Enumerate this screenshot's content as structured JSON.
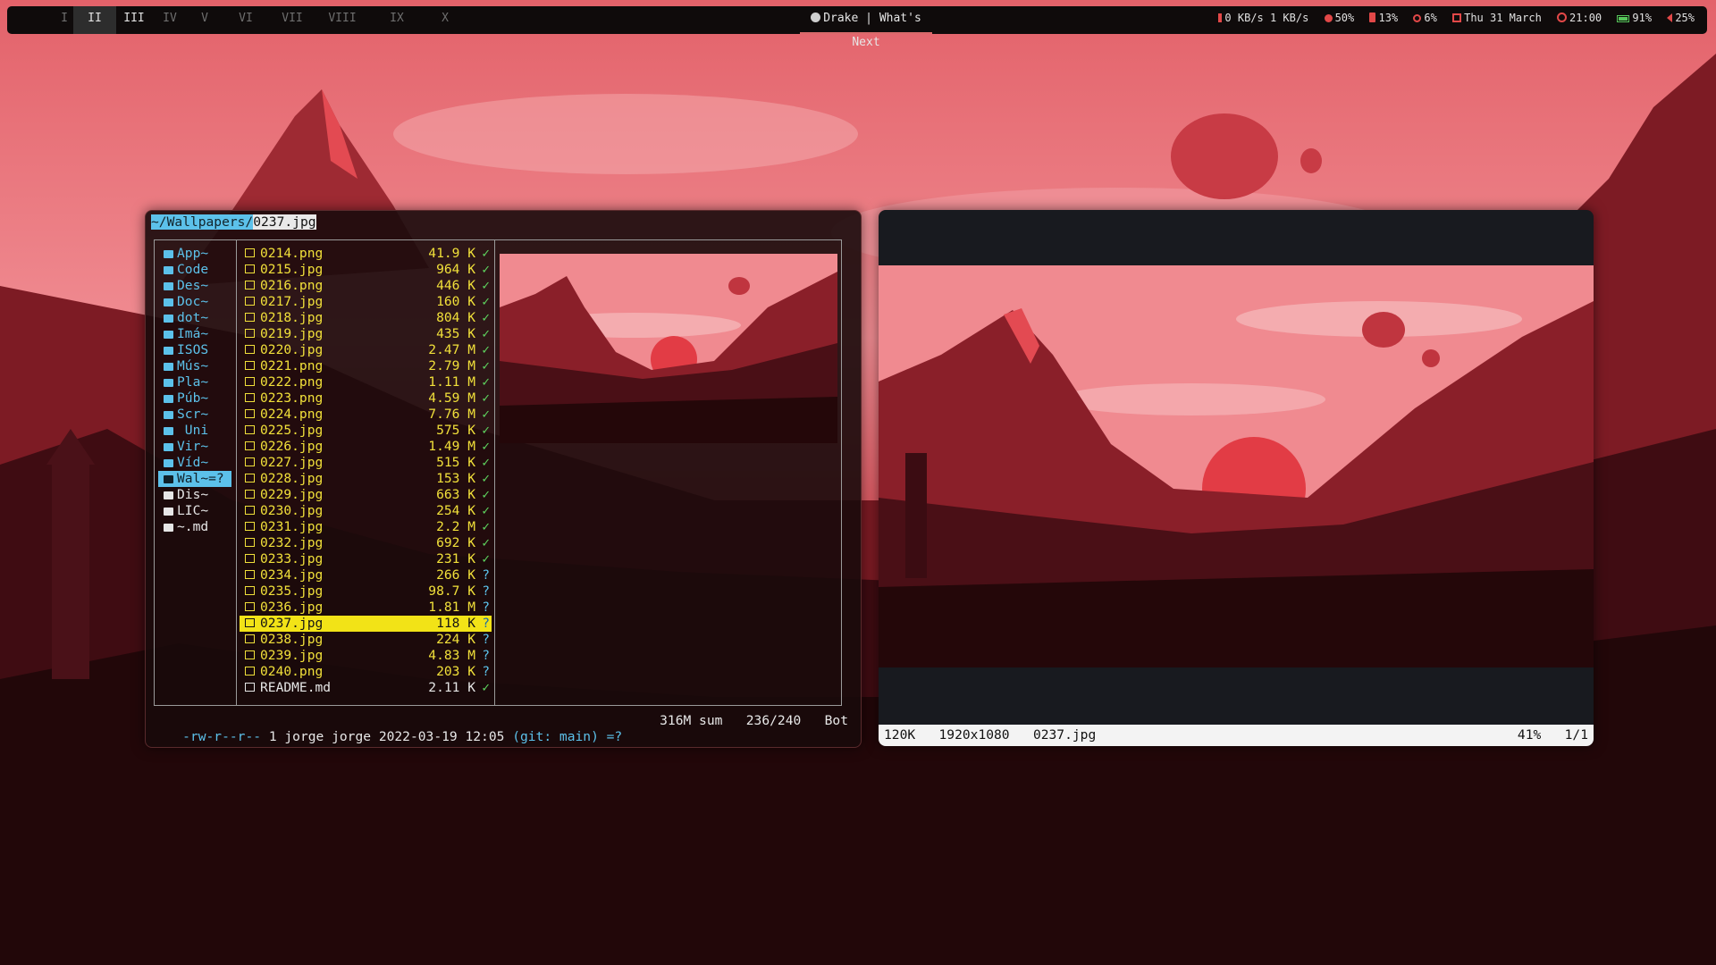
{
  "bar": {
    "workspaces": [
      {
        "label": "I",
        "state": "empty"
      },
      {
        "label": "II",
        "state": "active"
      },
      {
        "label": "III",
        "state": "occupied"
      },
      {
        "label": "IV",
        "state": "empty"
      },
      {
        "label": "V",
        "state": "empty"
      },
      {
        "label": "VI",
        "state": "empty"
      },
      {
        "label": "VII",
        "state": "empty"
      },
      {
        "label": "VIII",
        "state": "empty"
      },
      {
        "label": "IX",
        "state": "empty"
      },
      {
        "label": "X",
        "state": "empty"
      }
    ],
    "now_playing": "Drake | What's Next",
    "network": "0 KB/s 1 KB/s",
    "cpu": "50%",
    "memory": "13%",
    "disk": "6%",
    "date": "Thu 31 March",
    "time": "21:00",
    "battery": "91%",
    "volume": "25%",
    "accent_color": "#e24848",
    "battery_color": "#56c65a"
  },
  "ranger": {
    "path_dir": "~/Wallpapers/",
    "path_file": "0237.jpg",
    "dirs": [
      {
        "label": "App~",
        "icon": "folder-icon",
        "selected": false
      },
      {
        "label": "Code",
        "icon": "code-icon",
        "selected": false
      },
      {
        "label": "Des~",
        "icon": "download-icon",
        "selected": false
      },
      {
        "label": "Doc~",
        "icon": "document-icon",
        "selected": false
      },
      {
        "label": "dot~",
        "icon": "folder-icon",
        "selected": false
      },
      {
        "label": "Imá~",
        "icon": "image-icon",
        "selected": false
      },
      {
        "label": "ISOS",
        "icon": "folder-icon",
        "selected": false
      },
      {
        "label": "Mús~",
        "icon": "headphones-icon",
        "selected": false
      },
      {
        "label": "Pla~",
        "icon": "template-icon",
        "selected": false
      },
      {
        "label": "Púb~",
        "icon": "users-icon",
        "selected": false
      },
      {
        "label": "Scr~",
        "icon": "screenshot-icon",
        "selected": false
      },
      {
        "label": " Uni",
        "icon": "graduation-cap-icon",
        "selected": false
      },
      {
        "label": "Vir~",
        "icon": "folder-icon",
        "selected": false
      },
      {
        "label": "Víd~",
        "icon": "video-icon",
        "selected": false
      },
      {
        "label": "Wal~=?",
        "icon": "folder-icon",
        "selected": true
      },
      {
        "label": "Dis~",
        "icon": "list-icon",
        "selected": false,
        "plain": true
      },
      {
        "label": "LIC~",
        "icon": "license-icon",
        "selected": false,
        "plain": true
      },
      {
        "label": "~.md",
        "icon": "markdown-icon",
        "selected": false,
        "plain": true
      }
    ],
    "files": [
      {
        "name": "0214.png",
        "size": "41.9 K",
        "flag": "✓"
      },
      {
        "name": "0215.jpg",
        "size": "964 K",
        "flag": "✓"
      },
      {
        "name": "0216.png",
        "size": "446 K",
        "flag": "✓"
      },
      {
        "name": "0217.jpg",
        "size": "160 K",
        "flag": "✓"
      },
      {
        "name": "0218.jpg",
        "size": "804 K",
        "flag": "✓"
      },
      {
        "name": "0219.jpg",
        "size": "435 K",
        "flag": "✓"
      },
      {
        "name": "0220.jpg",
        "size": "2.47 M",
        "flag": "✓"
      },
      {
        "name": "0221.png",
        "size": "2.79 M",
        "flag": "✓"
      },
      {
        "name": "0222.png",
        "size": "1.11 M",
        "flag": "✓"
      },
      {
        "name": "0223.png",
        "size": "4.59 M",
        "flag": "✓"
      },
      {
        "name": "0224.png",
        "size": "7.76 M",
        "flag": "✓"
      },
      {
        "name": "0225.jpg",
        "size": "575 K",
        "flag": "✓"
      },
      {
        "name": "0226.jpg",
        "size": "1.49 M",
        "flag": "✓"
      },
      {
        "name": "0227.jpg",
        "size": "515 K",
        "flag": "✓"
      },
      {
        "name": "0228.jpg",
        "size": "153 K",
        "flag": "✓"
      },
      {
        "name": "0229.jpg",
        "size": "663 K",
        "flag": "✓"
      },
      {
        "name": "0230.jpg",
        "size": "254 K",
        "flag": "✓"
      },
      {
        "name": "0231.jpg",
        "size": "2.2 M",
        "flag": "✓"
      },
      {
        "name": "0232.jpg",
        "size": "692 K",
        "flag": "✓"
      },
      {
        "name": "0233.jpg",
        "size": "231 K",
        "flag": "✓"
      },
      {
        "name": "0234.jpg",
        "size": "266 K",
        "flag": "?"
      },
      {
        "name": "0235.jpg",
        "size": "98.7 K",
        "flag": "?"
      },
      {
        "name": "0236.jpg",
        "size": "1.81 M",
        "flag": "?"
      },
      {
        "name": "0237.jpg",
        "size": "118 K",
        "flag": "?",
        "selected": true
      },
      {
        "name": "0238.jpg",
        "size": "224 K",
        "flag": "?"
      },
      {
        "name": "0239.jpg",
        "size": "4.83 M",
        "flag": "?"
      },
      {
        "name": "0240.png",
        "size": "203 K",
        "flag": "?"
      },
      {
        "name": "README.md",
        "size": "2.11 K",
        "flag": "✓",
        "plain": true
      }
    ],
    "status": {
      "permissions": "-rw-r--r--",
      "owner": " 1 jorge jorge 2022-03-19 12:05 ",
      "git": "(git: main)",
      "git_state": " =?",
      "summary": "316M sum   236/240   Bot"
    },
    "file_color": "#f1e03a",
    "dir_color": "#5cc1ea"
  },
  "viewer": {
    "file_size": "120K",
    "dimensions": "1920x1080",
    "filename": "0237.jpg",
    "zoom": "41%",
    "index": "1/1"
  }
}
